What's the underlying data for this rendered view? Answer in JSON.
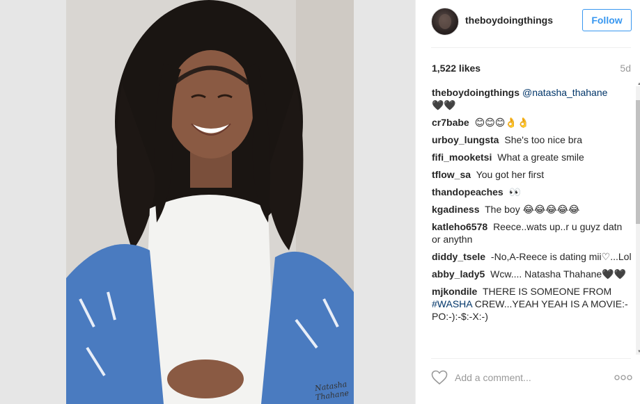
{
  "photo": {
    "signature_line1": "Natasha",
    "signature_line2": "Thahane"
  },
  "header": {
    "username": "theboydoingthings",
    "follow_label": "Follow"
  },
  "stats": {
    "likes": "1,522 likes",
    "time": "5d"
  },
  "comments": [
    {
      "user": "theboydoingthings",
      "mention": "@natasha_thahane",
      "text": "🖤🖤"
    },
    {
      "user": "cr7babe",
      "text": "😊😊😊👌👌"
    },
    {
      "user": "urboy_lungsta",
      "text": "She's too nice bra"
    },
    {
      "user": "fifi_mooketsi",
      "text": "What a greate smile"
    },
    {
      "user": "tflow_sa",
      "text": "You got her first"
    },
    {
      "user": "thandopeaches",
      "text": "👀"
    },
    {
      "user": "kgadiness",
      "text": "The boy 😂😂😂😂😂"
    },
    {
      "user": "katleho6578",
      "text": "Reece..wats up..r u guyz datn or anythn"
    },
    {
      "user": "diddy_tsele",
      "text": "-No,A-Reece is dating mii♡...Lol"
    },
    {
      "user": "abby_lady5",
      "text": "Wcw.... Natasha Thahane🖤🖤"
    },
    {
      "user": "mjkondile",
      "text_before": "THERE IS SOMEONE FROM",
      "hashtag": "#WASHA",
      "text_after": "CREW...YEAH YEAH IS A MOVIE:-PO:-):-$:-X:-)"
    }
  ],
  "footer": {
    "comment_placeholder": "Add a comment...",
    "heart_icon": "heart-icon",
    "more_icon": "more-options-icon"
  },
  "colors": {
    "accent": "#3897f0",
    "link": "#003569",
    "muted": "#999999"
  }
}
